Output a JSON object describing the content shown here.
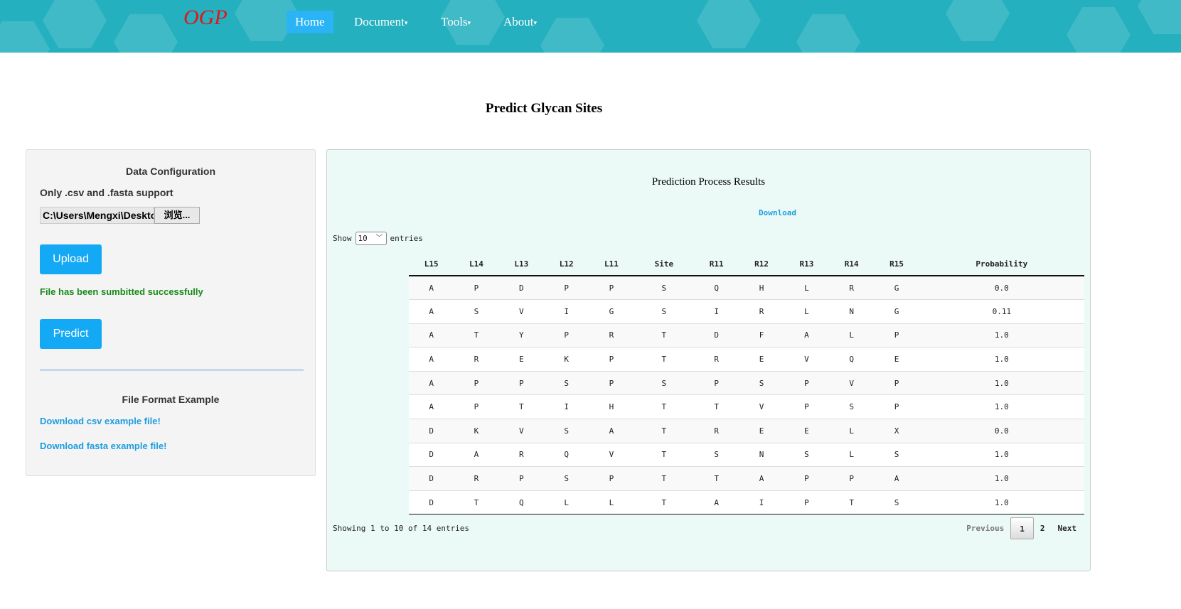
{
  "header": {
    "logo": "OGP",
    "nav": [
      {
        "label": "Home",
        "active": true
      },
      {
        "label": "Document",
        "caret": "▾"
      },
      {
        "label": "Tools",
        "caret": "▾"
      },
      {
        "label": "About",
        "caret": "▾"
      }
    ]
  },
  "page_title": "Predict Glycan Sites",
  "config": {
    "title": "Data Configuration",
    "support": "Only .csv and .fasta support",
    "file_path": "C:\\Users\\Mengxi\\Desktop",
    "browse": "浏览...",
    "upload": "Upload",
    "status": "File has been sumbitted successfully",
    "predict": "Predict",
    "example_title": "File Format Example",
    "csv_link": "Download csv example file!",
    "fasta_link": "Download fasta example file!"
  },
  "results": {
    "title": "Prediction Process Results",
    "download": "Download",
    "show": "Show",
    "page_size": "10",
    "entries": "entries",
    "columns": [
      "L15",
      "L14",
      "L13",
      "L12",
      "L11",
      "Site",
      "R11",
      "R12",
      "R13",
      "R14",
      "R15",
      "Probability"
    ],
    "rows": [
      [
        "A",
        "P",
        "D",
        "P",
        "P",
        "S",
        "Q",
        "H",
        "L",
        "R",
        "G",
        "0.0"
      ],
      [
        "A",
        "S",
        "V",
        "I",
        "G",
        "S",
        "I",
        "R",
        "L",
        "N",
        "G",
        "0.11"
      ],
      [
        "A",
        "T",
        "Y",
        "P",
        "R",
        "T",
        "D",
        "F",
        "A",
        "L",
        "P",
        "1.0"
      ],
      [
        "A",
        "R",
        "E",
        "K",
        "P",
        "T",
        "R",
        "E",
        "V",
        "Q",
        "E",
        "1.0"
      ],
      [
        "A",
        "P",
        "P",
        "S",
        "P",
        "S",
        "P",
        "S",
        "P",
        "V",
        "P",
        "1.0"
      ],
      [
        "A",
        "P",
        "T",
        "I",
        "H",
        "T",
        "T",
        "V",
        "P",
        "S",
        "P",
        "1.0"
      ],
      [
        "D",
        "K",
        "V",
        "S",
        "A",
        "T",
        "R",
        "E",
        "E",
        "L",
        "X",
        "0.0"
      ],
      [
        "D",
        "A",
        "R",
        "Q",
        "V",
        "T",
        "S",
        "N",
        "S",
        "L",
        "S",
        "1.0"
      ],
      [
        "D",
        "R",
        "P",
        "S",
        "P",
        "T",
        "T",
        "A",
        "P",
        "P",
        "A",
        "1.0"
      ],
      [
        "D",
        "T",
        "Q",
        "L",
        "L",
        "T",
        "A",
        "I",
        "P",
        "T",
        "S",
        "1.0"
      ]
    ],
    "info": "Showing 1 to 10 of 14 entries",
    "pagination": {
      "previous": "Previous",
      "pages": [
        "1",
        "2"
      ],
      "current": "1",
      "next": "Next"
    }
  }
}
